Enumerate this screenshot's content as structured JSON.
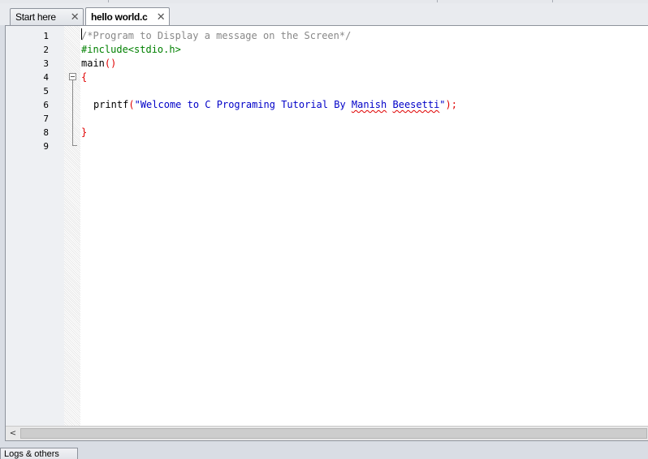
{
  "tabs": [
    {
      "label": "Start here",
      "active": false
    },
    {
      "label": "hello world.c",
      "active": true
    }
  ],
  "close_glyph": "✕",
  "line_numbers": [
    "1",
    "2",
    "3",
    "4",
    "5",
    "6",
    "7",
    "8",
    "9"
  ],
  "code": {
    "line1": "/*Program to Display a message on the Screen*/",
    "line2": "#include<stdio.h>",
    "line3_name": "main",
    "line3_parens": "()",
    "line4": "{",
    "line6_fn": "printf",
    "line6_open": "(",
    "line6_str_a": "\"Welcome to C Programing Tutorial By ",
    "line6_str_b": "Manish",
    "line6_str_c": " ",
    "line6_str_d": "Beesetti",
    "line6_str_e": "\"",
    "line6_close": ");",
    "line8": "}"
  },
  "scroll_left_glyph": "<",
  "bottom_panel": {
    "label": "Logs & others"
  },
  "colors": {
    "comment": "#888888",
    "preprocessor": "#008000",
    "operator": "#e00000",
    "string": "#0000c8"
  },
  "icons": {
    "fold": "fold-minus-icon",
    "close": "close-icon",
    "scroll_left": "chevron-left-icon"
  }
}
